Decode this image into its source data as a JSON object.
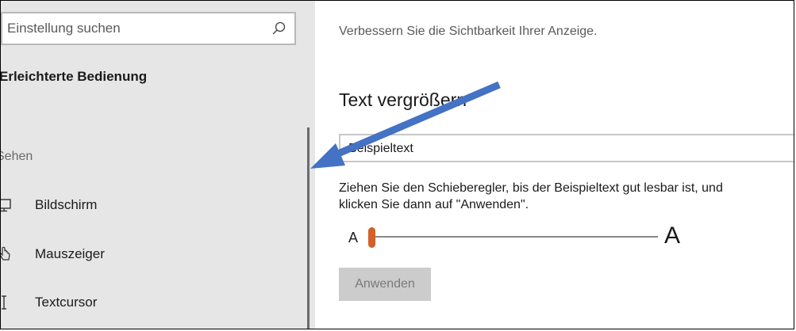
{
  "sidebar": {
    "search": {
      "placeholder": "Einstellung suchen",
      "icon": "search-icon"
    },
    "title": "Erleichterte Bedienung",
    "group": "Sehen",
    "items": [
      {
        "label": "Bildschirm",
        "icon": "monitor-icon"
      },
      {
        "label": "Mauszeiger",
        "icon": "mouse-pointer-icon"
      },
      {
        "label": "Textcursor",
        "icon": "text-cursor-icon"
      }
    ]
  },
  "main": {
    "subtitle": "Verbessern Sie die Sichtbarkeit Ihrer Anzeige.",
    "heading": "Text vergrößern",
    "sample_text": "Beispieltext",
    "instruction_line1": "Ziehen Sie den Schieberegler, bis der Beispieltext gut lesbar ist, und",
    "instruction_line2": "klicken Sie dann auf \"Anwenden\".",
    "slider": {
      "small_label": "A",
      "large_label": "A",
      "value_percent": 0,
      "accent": "#d4602a"
    },
    "apply_label": "Anwenden"
  },
  "annotation": {
    "arrow_color": "#4472c4"
  }
}
